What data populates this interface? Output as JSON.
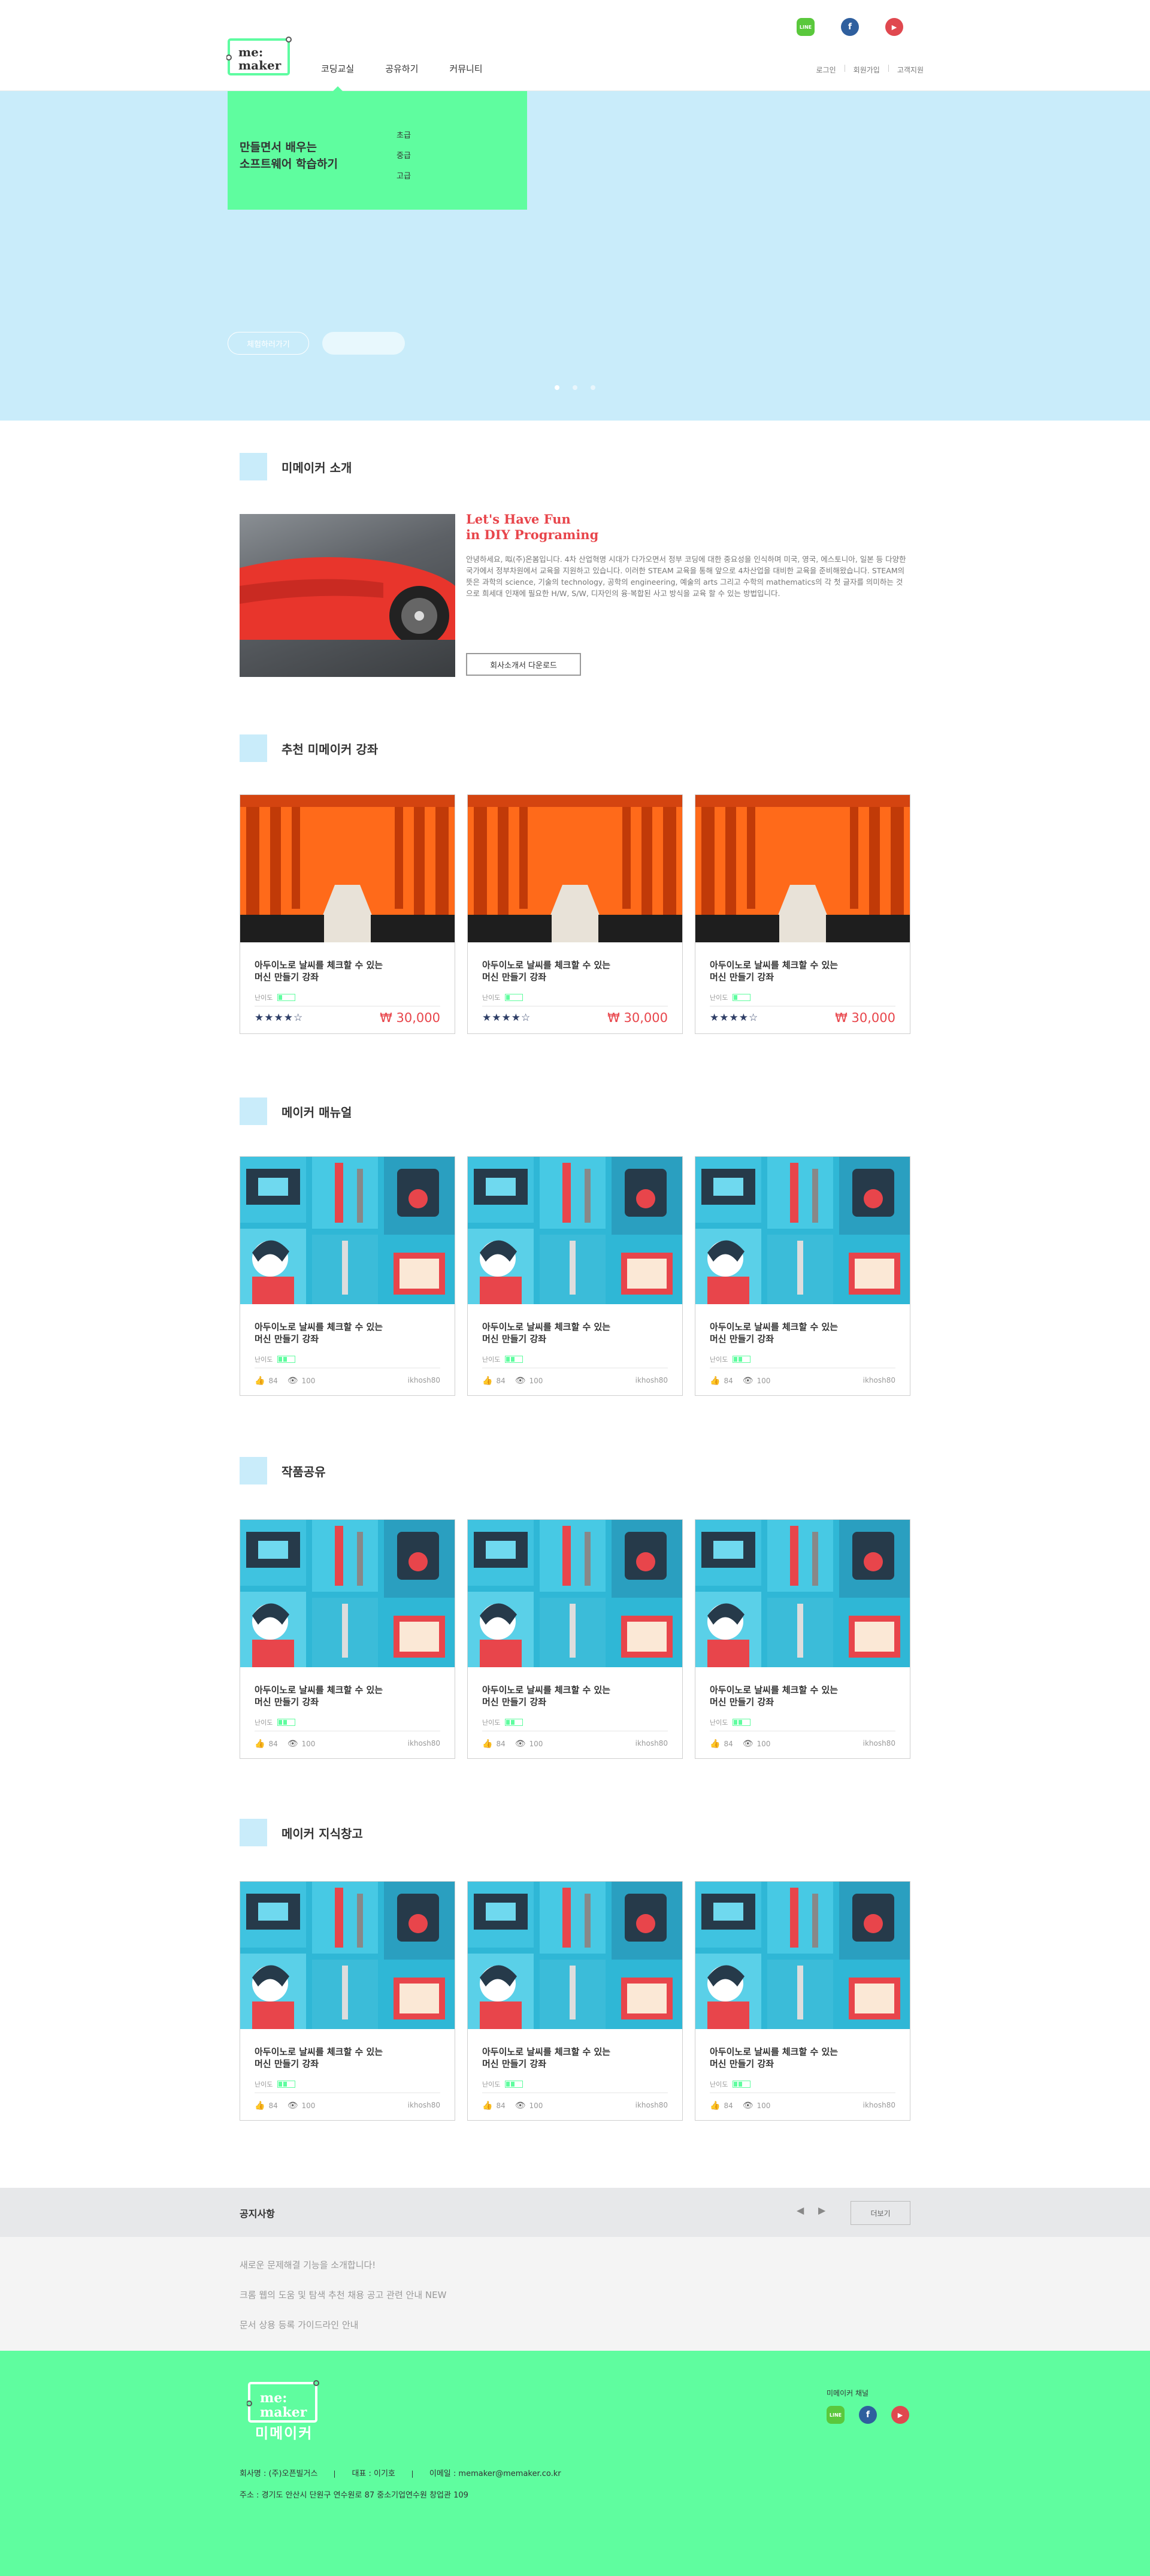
{
  "header": {
    "logo_text_1": "me:",
    "logo_text_2": "maker",
    "nav": [
      "코딩교실",
      "공유하기",
      "커뮤니티"
    ],
    "sns": [
      {
        "name": "line",
        "glyph": "LINE"
      },
      {
        "name": "facebook",
        "glyph": "f"
      },
      {
        "name": "youtube",
        "glyph": "▶"
      }
    ],
    "util": [
      "로그인",
      "회원가입",
      "고객지원"
    ],
    "accent_color": "#5efca1"
  },
  "hero": {
    "menu_title": "만들면서 배우는\n소프트웨어 학습하기",
    "menu_levels": [
      "초급",
      "중급",
      "고급"
    ],
    "button_1": "체험하러가기",
    "background": "#c9ecfa"
  },
  "intro": {
    "section_title": "미메이커 소개",
    "heading": "Let's Have Fun\nin DIY Programing",
    "body": "안녕하세요, 㕽(주)온봄입니다. 4차 산업혁명 시대가 다가오면서 정부 코딩에 대한 중요성을 인식하며 미국, 영국, 에스토니아, 일본 등 다양한 국가에서 정부차원에서 교육을 지원하고 있습니다. 이러한 STEAM 교육을 통해 앞으로 4차산업을 대비한 교육을 준비해왔습니다. STEAM의 뜻은 과학의 science, 기술의 technology, 공학의 engineering, 예술의 arts 그리고 수학의 mathematics의 각 첫 글자를 의미하는 것으로 희세대 인재에 필요한 H/W, S/W, 디자인의 융·복합된 사고 방식을 교육 할 수 있는 방법입니다.",
    "download_button": "회사소개서 다운로드"
  },
  "recommended": {
    "section_title": "추천 미메이커 강좌",
    "cards": [
      {
        "title": "아두이노로 날씨를 체크할 수 있는\n머신 만들기 강좌",
        "level_label": "난이도",
        "stars": "★★★★☆",
        "rating": 4,
        "price": "₩ 30,000"
      },
      {
        "title": "아두이노로 날씨를 체크할 수 있는\n머신 만들기 강좌",
        "level_label": "난이도",
        "stars": "★★★★☆",
        "rating": 4,
        "price": "₩ 30,000"
      },
      {
        "title": "아두이노로 날씨를 체크할 수 있는\n머신 만들기 강좌",
        "level_label": "난이도",
        "stars": "★★★★☆",
        "rating": 4,
        "price": "₩ 30,000"
      }
    ]
  },
  "manual": {
    "section_title": "메이커 매뉴얼",
    "cards": [
      {
        "title": "아두이노로 날씨를 체크할 수 있는\n머신 만들기 강좌",
        "level_label": "난이도",
        "likes": "84",
        "views": "100",
        "author": "ikhosh80"
      },
      {
        "title": "아두이노로 날씨를 체크할 수 있는\n머신 만들기 강좌",
        "level_label": "난이도",
        "likes": "84",
        "views": "100",
        "author": "ikhosh80"
      },
      {
        "title": "아두이노로 날씨를 체크할 수 있는\n머신 만들기 강좌",
        "level_label": "난이도",
        "likes": "84",
        "views": "100",
        "author": "ikhosh80"
      }
    ]
  },
  "share": {
    "section_title": "작품공유",
    "cards": [
      {
        "title": "아두이노로 날씨를 체크할 수 있는\n머신 만들기 강좌",
        "level_label": "난이도",
        "likes": "84",
        "views": "100",
        "author": "ikhosh80"
      },
      {
        "title": "아두이노로 날씨를 체크할 수 있는\n머신 만들기 강좌",
        "level_label": "난이도",
        "likes": "84",
        "views": "100",
        "author": "ikhosh80"
      },
      {
        "title": "아두이노로 날씨를 체크할 수 있는\n머신 만들기 강좌",
        "level_label": "난이도",
        "likes": "84",
        "views": "100",
        "author": "ikhosh80"
      }
    ]
  },
  "knowledge": {
    "section_title": "메이커 지식창고",
    "cards": [
      {
        "title": "아두이노로 날씨를 체크할 수 있는\n머신 만들기 강좌",
        "level_label": "난이도",
        "likes": "84",
        "views": "100",
        "author": "ikhosh80"
      },
      {
        "title": "아두이노로 날씨를 체크할 수 있는\n머신 만들기 강좌",
        "level_label": "난이도",
        "likes": "84",
        "views": "100",
        "author": "ikhosh80"
      },
      {
        "title": "아두이노로 날씨를 체크할 수 있는\n머신 만들기 강좌",
        "level_label": "난이도",
        "likes": "84",
        "views": "100",
        "author": "ikhosh80"
      }
    ]
  },
  "notice": {
    "label": "공지사항",
    "prev": "◀",
    "next": "▶",
    "more": "더보기",
    "items": [
      "새로운 문제해결 기능을 소개합니다!",
      "크롬 웹의 도움 및 탐색 추천 채용 공고 관련 안내 NEW",
      "문서 상용 등록 가이드라인 안내"
    ]
  },
  "footer": {
    "logo_text_1": "me:",
    "logo_text_2": "maker",
    "brand": "미메이커",
    "company": "회사명 : (주)오픈빌거스",
    "ceo": "대표 : 이기호",
    "email": "이메일 : memaker@memaker.co.kr",
    "address": "주소 : 경기도 안산시 단원구 연수원로 87 중소기업연수원 창업관 109",
    "channel_label": "미메이커 채널",
    "sns": [
      {
        "name": "line",
        "glyph": "LINE"
      },
      {
        "name": "facebook",
        "glyph": "f"
      },
      {
        "name": "youtube",
        "glyph": "▶"
      }
    ]
  }
}
